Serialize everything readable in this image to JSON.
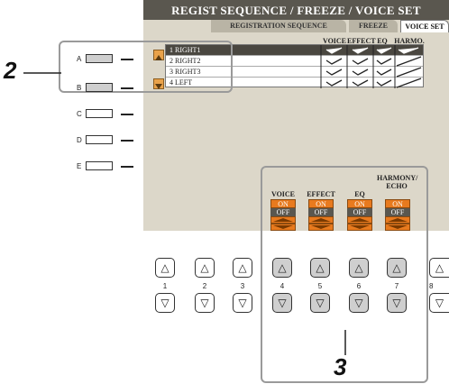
{
  "screen": {
    "title": "REGIST SEQUENCE / FREEZE / VOICE SET",
    "tabs": [
      "REGISTRATION SEQUENCE",
      "FREEZE",
      "VOICE SET"
    ],
    "columns": [
      "VOICE",
      "EFFECT",
      "EQ",
      "HARMO."
    ],
    "parts": [
      {
        "label": "1  RIGHT1"
      },
      {
        "label": "2  RIGHT2"
      },
      {
        "label": "3  RIGHT3"
      },
      {
        "label": "4  LEFT"
      }
    ]
  },
  "side_buttons": [
    "A",
    "B",
    "C",
    "D",
    "E"
  ],
  "knobs": [
    {
      "head": "VOICE",
      "on": "ON",
      "off": "OFF"
    },
    {
      "head": "EFFECT",
      "on": "ON",
      "off": "OFF"
    },
    {
      "head": "EQ",
      "on": "ON",
      "off": "OFF"
    },
    {
      "head": "HARMONY/\nECHO",
      "on": "ON",
      "off": "OFF"
    }
  ],
  "bottom_buttons": [
    "1",
    "2",
    "3",
    "4",
    "5",
    "6",
    "7",
    "8"
  ],
  "up_glyph": "△",
  "down_glyph": "▽",
  "callouts": {
    "left": "2",
    "bottom": "3"
  },
  "colors": {
    "accent": "#e87a1e",
    "lcd_bg": "#dcd7c9",
    "header": "#5a574f"
  }
}
